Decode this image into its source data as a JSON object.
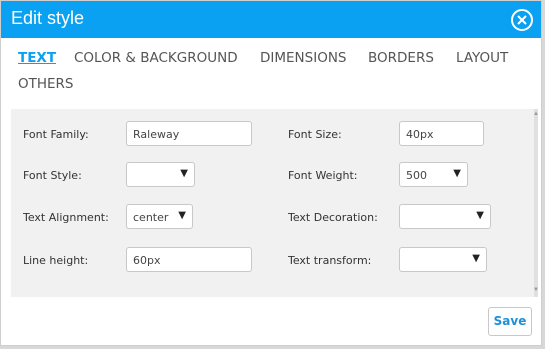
{
  "dialog": {
    "title": "Edit style",
    "close_icon": "close-circle-icon"
  },
  "tabs": [
    {
      "label": "TEXT",
      "active": true
    },
    {
      "label": "COLOR & BACKGROUND",
      "active": false
    },
    {
      "label": "DIMENSIONS",
      "active": false
    },
    {
      "label": "BORDERS",
      "active": false
    },
    {
      "label": "LAYOUT",
      "active": false
    },
    {
      "label": "OTHERS",
      "active": false
    }
  ],
  "form": {
    "font_family": {
      "label": "Font Family:",
      "value": "Raleway"
    },
    "font_size": {
      "label": "Font Size:",
      "value": "40px"
    },
    "font_style": {
      "label": "Font Style:",
      "value": ""
    },
    "font_weight": {
      "label": "Font Weight:",
      "value": "500"
    },
    "text_alignment": {
      "label": "Text Alignment:",
      "value": "center"
    },
    "text_decoration": {
      "label": "Text Decoration:",
      "value": ""
    },
    "line_height": {
      "label": "Line height:",
      "value": "60px"
    },
    "text_transform": {
      "label": "Text transform:",
      "value": ""
    }
  },
  "footer": {
    "save_label": "Save"
  },
  "colors": {
    "accent": "#0aa1f2",
    "panel_bg": "#f1f1f1"
  }
}
